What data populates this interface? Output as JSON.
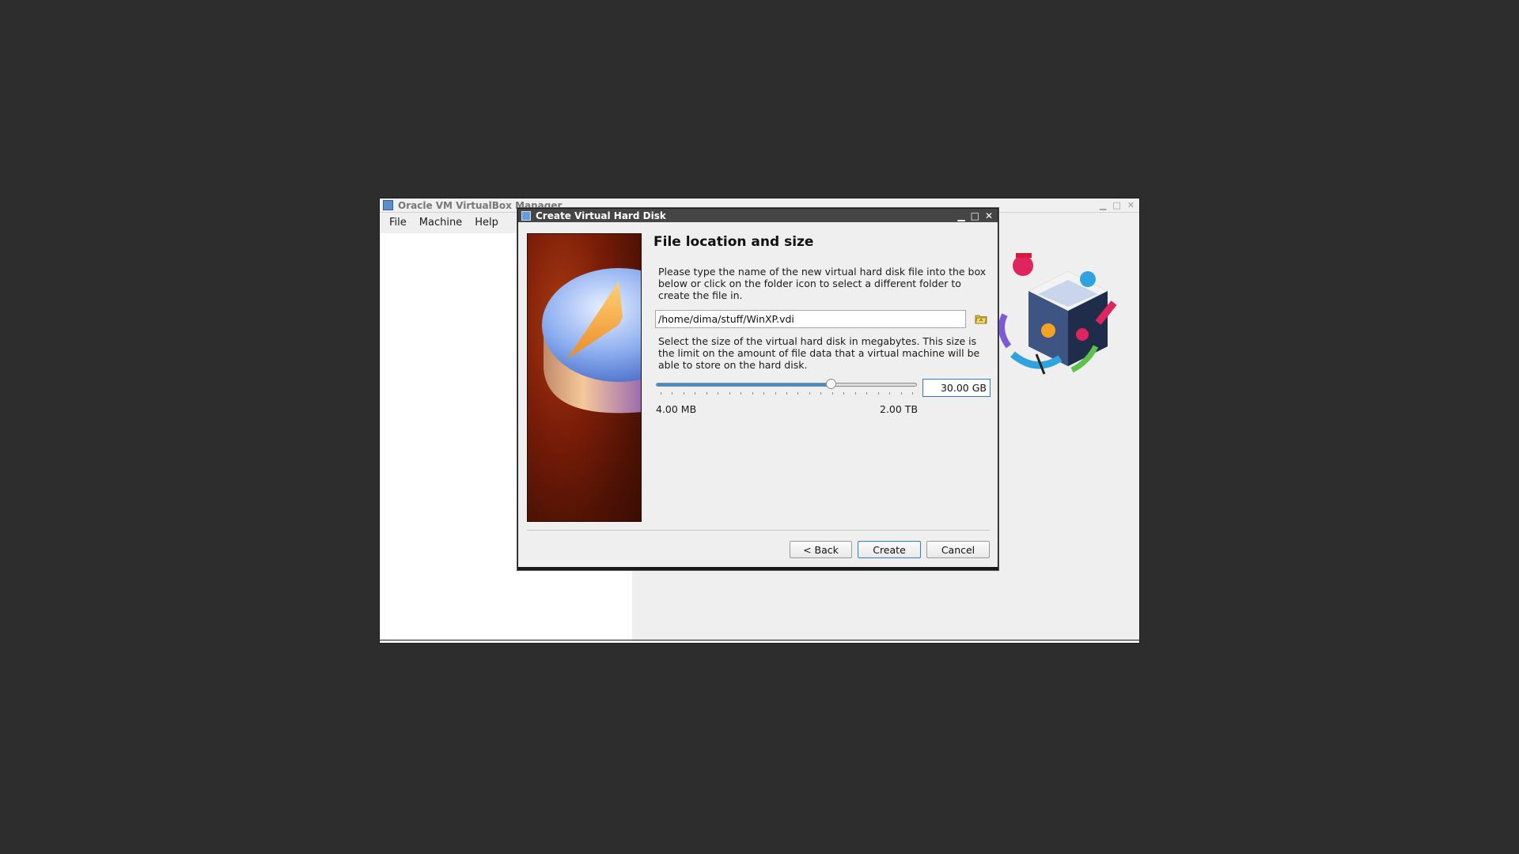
{
  "manager": {
    "title": "Oracle VM VirtualBox Manager",
    "menu": [
      "File",
      "Machine",
      "Help"
    ]
  },
  "dialog": {
    "title": "Create Virtual Hard Disk",
    "heading": "File location and size",
    "location_description": "Please type the name of the new virtual hard disk file into the box below or click on the folder icon to select a different folder to create the file in.",
    "file_path": "/home/dima/stuff/WinXP.vdi",
    "size_description": "Select the size of the virtual hard disk in megabytes. This size is the limit on the amount of file data that a virtual machine will be able to store on the hard disk.",
    "size_value": "30.00 GB",
    "slider_level": 0.67,
    "min_label": "4.00 MB",
    "max_label": "2.00 TB",
    "buttons": {
      "back": "< Back",
      "create": "Create",
      "cancel": "Cancel"
    }
  },
  "icons": {
    "app": "virtualbox-icon",
    "folder": "folder-open-icon",
    "minimize": "minimize-icon",
    "maximize": "maximize-icon",
    "close": "close-icon"
  },
  "colors": {
    "slider_fill": "#3d8fd1",
    "dialog_title_bar": "#454545",
    "focus_border": "#2f7fce"
  }
}
